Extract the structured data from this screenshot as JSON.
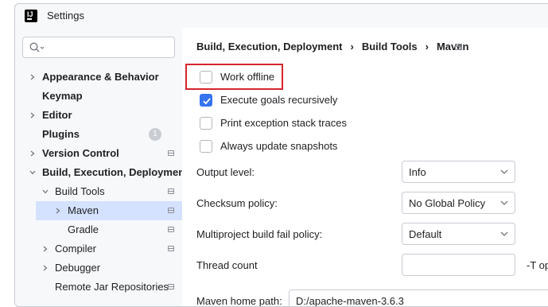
{
  "window": {
    "title": "Settings",
    "app_icon_text": "IJ"
  },
  "search": {
    "placeholder": ""
  },
  "tree": [
    {
      "label": "Appearance & Behavior",
      "bold": true,
      "chevron": "right",
      "indent": 0
    },
    {
      "label": "Keymap",
      "bold": true,
      "chevron": "",
      "indent": 0
    },
    {
      "label": "Editor",
      "bold": true,
      "chevron": "right",
      "indent": 0
    },
    {
      "label": "Plugins",
      "bold": true,
      "chevron": "",
      "indent": 0,
      "badge": "1"
    },
    {
      "label": "Version Control",
      "bold": true,
      "chevron": "right",
      "indent": 0,
      "project": true
    },
    {
      "label": "Build, Execution, Deployment",
      "bold": true,
      "chevron": "down",
      "indent": 0
    },
    {
      "label": "Build Tools",
      "bold": false,
      "chevron": "down",
      "indent": 1,
      "project": true
    },
    {
      "label": "Maven",
      "bold": false,
      "chevron": "right",
      "indent": 2,
      "project": true,
      "selected": true
    },
    {
      "label": "Gradle",
      "bold": false,
      "chevron": "",
      "indent": 2,
      "project": true
    },
    {
      "label": "Compiler",
      "bold": false,
      "chevron": "right",
      "indent": 1,
      "project": true
    },
    {
      "label": "Debugger",
      "bold": false,
      "chevron": "right",
      "indent": 1
    },
    {
      "label": "Remote Jar Repositories",
      "bold": false,
      "chevron": "",
      "indent": 1,
      "project": true
    }
  ],
  "breadcrumbs": [
    "Build, Execution, Deployment",
    "Build Tools",
    "Maven"
  ],
  "breadcrumb_separator": "›",
  "options": [
    {
      "label": "Work offline",
      "checked": false
    },
    {
      "label": "Execute goals recursively",
      "checked": true
    },
    {
      "label": "Print exception stack traces",
      "checked": false
    },
    {
      "label": "Always update snapshots",
      "checked": false
    }
  ],
  "fields": {
    "output_level": {
      "label": "Output level:",
      "value": "Info"
    },
    "checksum_policy": {
      "label": "Checksum policy:",
      "value": "No Global Policy"
    },
    "multiproject_policy": {
      "label": "Multiproject build fail policy:",
      "value": "Default"
    },
    "thread_count": {
      "label": "Thread count",
      "value": "",
      "suffix": "-T op"
    },
    "maven_home": {
      "label": "Maven home path:",
      "value": "D:/apache-maven-3.6.3"
    }
  },
  "colors": {
    "accent": "#3574f0",
    "highlight_box": "#d6252d",
    "selection": "#d4e2ff"
  }
}
